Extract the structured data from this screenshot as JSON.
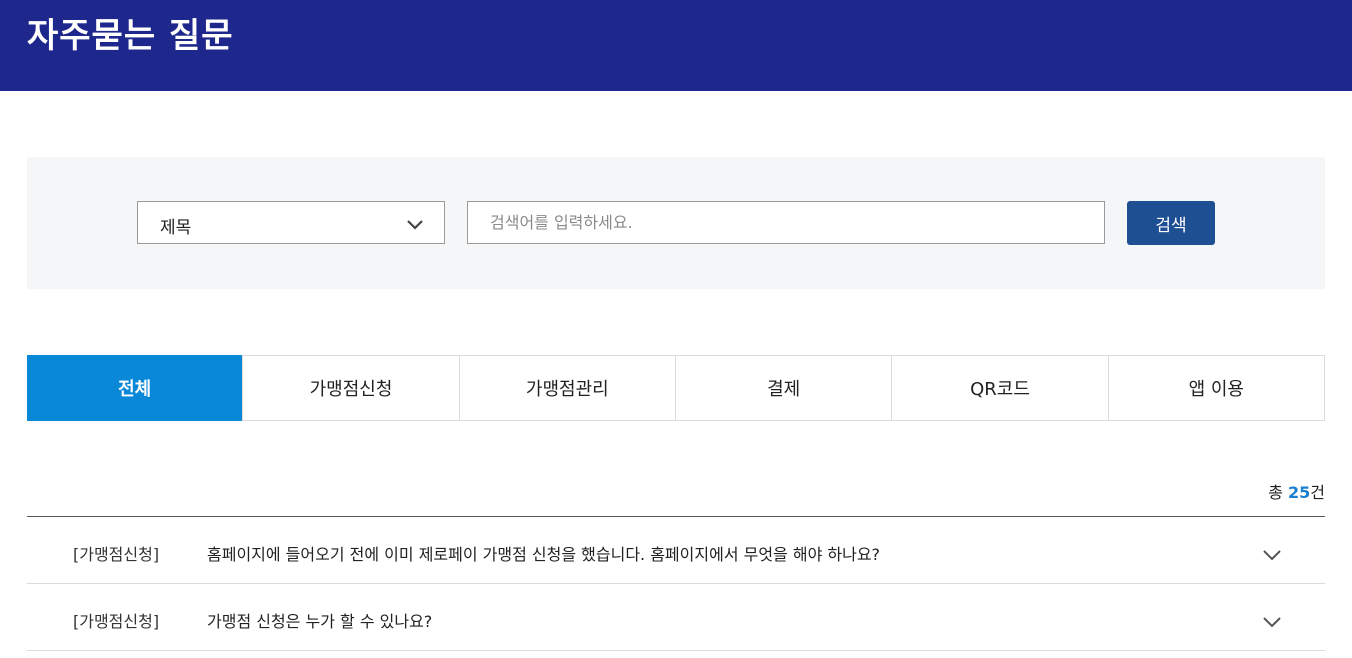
{
  "header": {
    "title": "자주묻는 질문"
  },
  "search": {
    "select_value": "제목",
    "placeholder": "검색어를 입력하세요.",
    "button_label": "검색"
  },
  "tabs": [
    {
      "label": "전체",
      "active": true
    },
    {
      "label": "가맹점신청",
      "active": false
    },
    {
      "label": "가맹점관리",
      "active": false
    },
    {
      "label": "결제",
      "active": false
    },
    {
      "label": "QR코드",
      "active": false
    },
    {
      "label": "앱 이용",
      "active": false
    }
  ],
  "count": {
    "prefix": "총 ",
    "number": "25",
    "suffix": "건"
  },
  "faq": [
    {
      "category": "[가맹점신청]",
      "question": "홈페이지에 들어오기 전에 이미 제로페이 가맹점 신청을 했습니다. 홈페이지에서 무엇을 해야 하나요?"
    },
    {
      "category": "[가맹점신청]",
      "question": "가맹점 신청은 누가 할 수 있나요?"
    }
  ],
  "colors": {
    "header_bg": "#1e288c",
    "active_tab": "#0a88d8",
    "search_button": "#1e4f93",
    "count_number": "#1a7fd0"
  }
}
